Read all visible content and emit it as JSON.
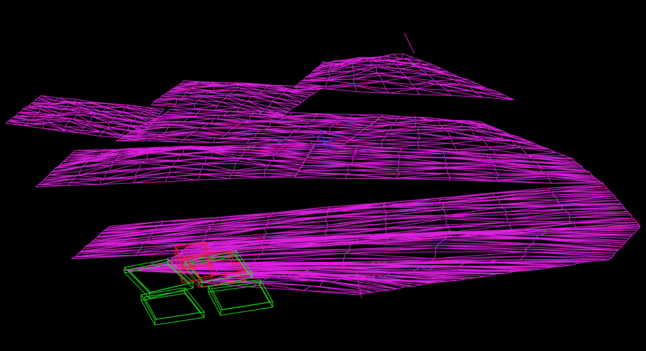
{
  "scene": {
    "background_color": "#000000",
    "terrain": {
      "color": "#e020e0",
      "render_mode": "wireframe",
      "tiles": 7
    },
    "selection_gizmo_color": "#2040ff",
    "objects": [
      {
        "kind": "green-box",
        "color": "#22ee22"
      },
      {
        "kind": "green-box",
        "color": "#22ee22"
      },
      {
        "kind": "green-box",
        "color": "#22ee22"
      },
      {
        "kind": "green-box",
        "color": "#22ee22"
      },
      {
        "kind": "red-box",
        "color": "#ee2222"
      },
      {
        "kind": "red-box",
        "color": "#ee2222"
      }
    ]
  }
}
